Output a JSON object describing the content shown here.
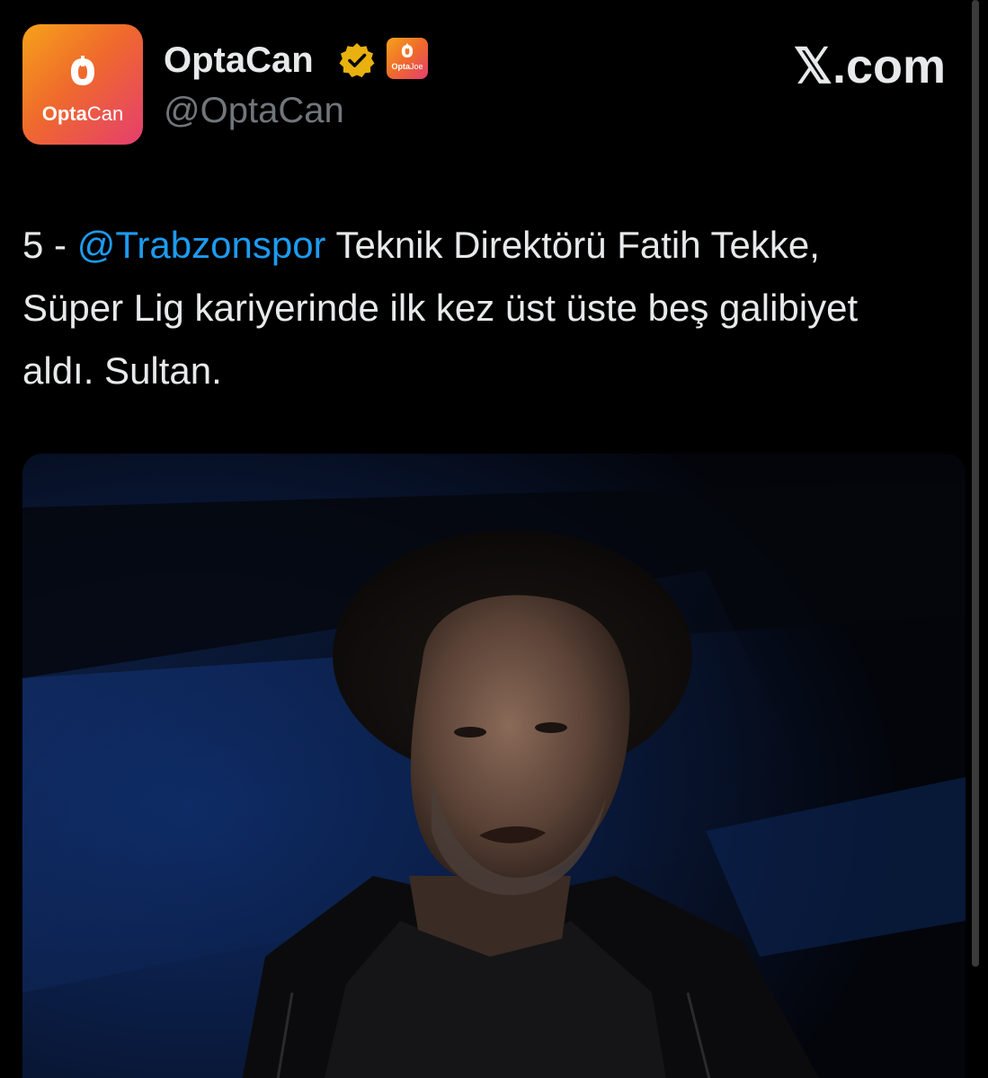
{
  "colors": {
    "background": "#000000",
    "text": "#e7e9ea",
    "muted": "#71767b",
    "mention": "#1d9bf0",
    "verified_badge": "#e8b10f",
    "brand_gradient": [
      "#f6a21a",
      "#ef6a2c",
      "#e53e6f"
    ]
  },
  "header": {
    "avatar": {
      "icon": "optacan-logo-icon",
      "brand_bold": "Opta",
      "brand_light": "Can"
    },
    "display_name": "OptaCan",
    "verified_icon": "verified-gold-badge-icon",
    "affiliate_badge": {
      "icon": "optajoe-badge-icon",
      "brand_bold": "Opta",
      "brand_light": "Joe"
    },
    "handle": "@OptaCan",
    "site_watermark": "𝕏.com"
  },
  "tweet": {
    "prefix": "5 - ",
    "mention": "@Trabzonspor",
    "body": " Teknik Direktörü Fatih Tekke, Süper Lig kariyerinde ilk kez üst üste beş galibiyet aldı. Sultan."
  },
  "media": {
    "type": "photo",
    "icon": "coach-portrait-photo"
  }
}
